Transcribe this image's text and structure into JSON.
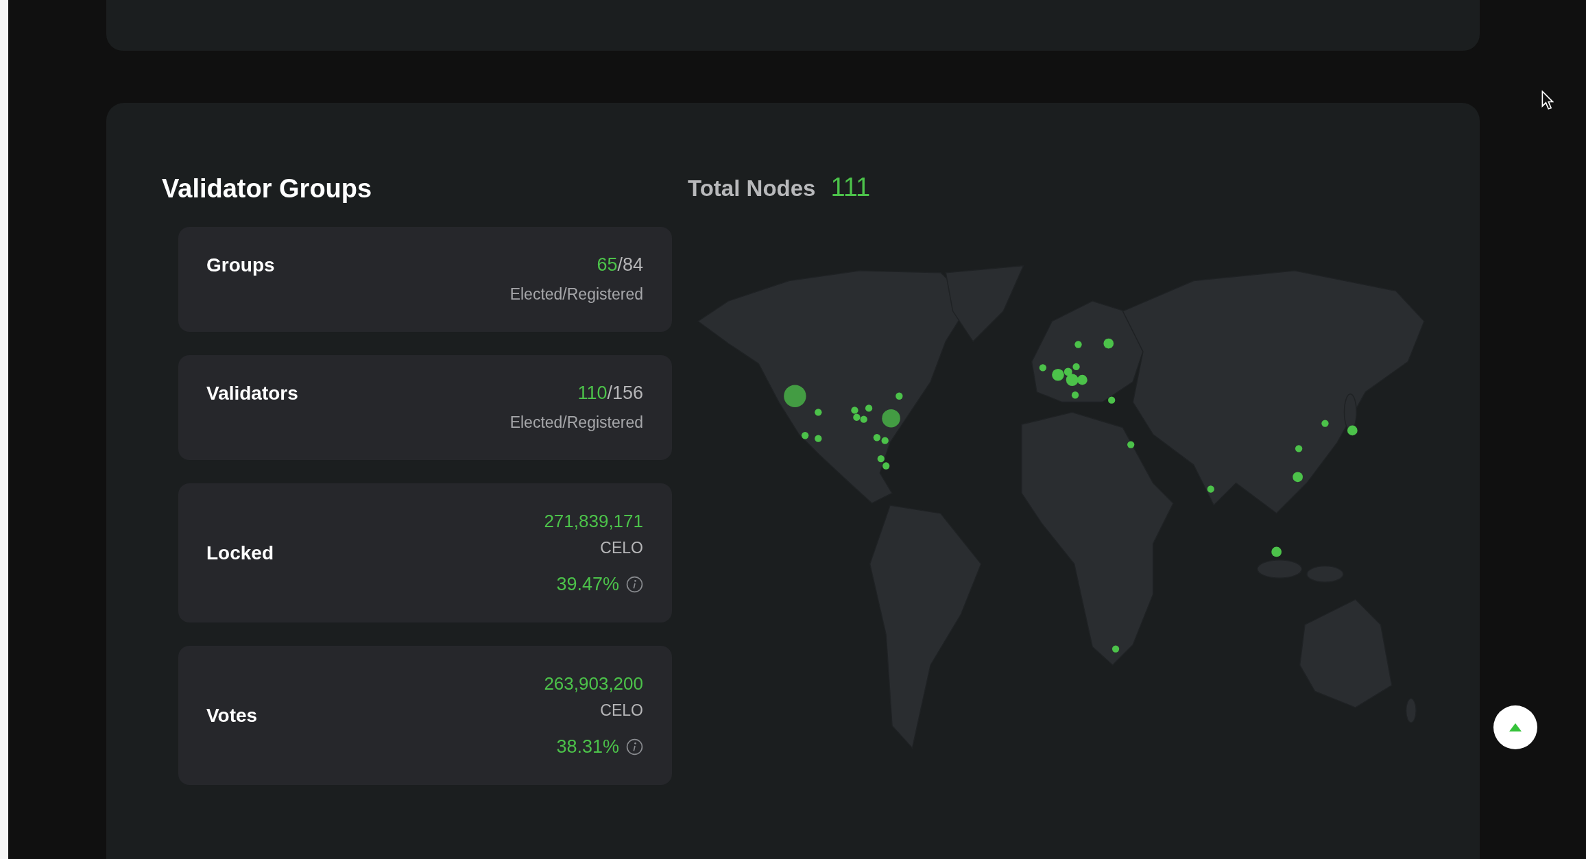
{
  "section": {
    "title": "Validator Groups"
  },
  "total_nodes": {
    "label": "Total Nodes",
    "value": "111"
  },
  "cards": [
    {
      "kind": "ratio",
      "label": "Groups",
      "elected": "65",
      "separator": "/",
      "registered": "84",
      "caption": "Elected/Registered"
    },
    {
      "kind": "ratio",
      "label": "Validators",
      "elected": "110",
      "separator": "/",
      "registered": "156",
      "caption": "Elected/Registered"
    },
    {
      "kind": "amount",
      "label": "Locked",
      "value": "271,839,171",
      "unit": "CELO",
      "percent": "39.47%"
    },
    {
      "kind": "amount",
      "label": "Votes",
      "value": "263,903,200",
      "unit": "CELO",
      "percent": "38.31%"
    }
  ]
}
